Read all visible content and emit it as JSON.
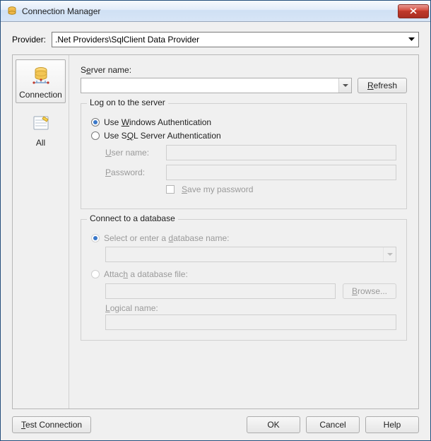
{
  "window": {
    "title": "Connection Manager"
  },
  "provider": {
    "label": "Provider:",
    "value": ".Net Providers\\SqlClient Data Provider"
  },
  "sidebar": {
    "items": [
      {
        "label": "Connection",
        "selected": true
      },
      {
        "label": "All",
        "selected": false
      }
    ]
  },
  "server": {
    "label": "Server name:",
    "value": "",
    "refresh": "Refresh"
  },
  "logon": {
    "legend": "Log on to the server",
    "windows_auth": "Use Windows Authentication",
    "sql_auth": "Use SQL Server Authentication",
    "username_label": "User name:",
    "username_value": "",
    "password_label": "Password:",
    "password_value": "",
    "save_password": "Save my password"
  },
  "db": {
    "legend": "Connect to a database",
    "select_label": "Select or enter a database name:",
    "select_value": "",
    "attach_label": "Attach a database file:",
    "attach_value": "",
    "browse": "Browse...",
    "logical_label": "Logical name:",
    "logical_value": ""
  },
  "footer": {
    "test": "Test Connection",
    "ok": "OK",
    "cancel": "Cancel",
    "help": "Help"
  }
}
